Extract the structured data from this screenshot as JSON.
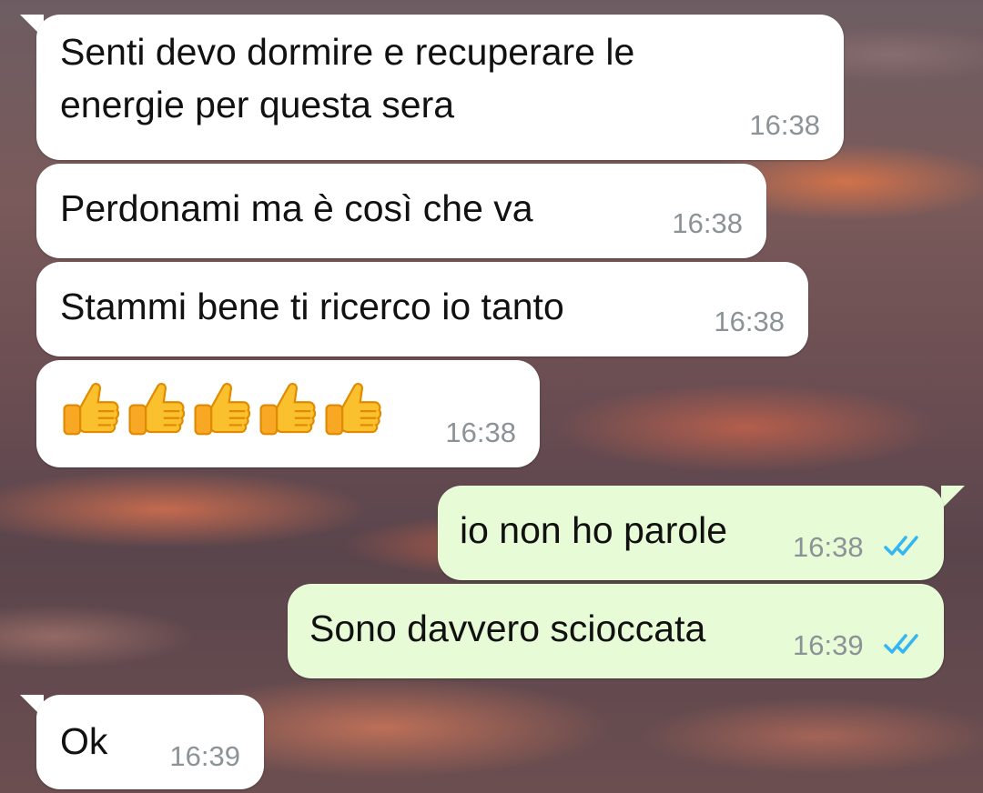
{
  "messages": [
    {
      "direction": "incoming",
      "text_line1": "Senti devo dormire e recuperare le",
      "text_line2": "energie per questa sera",
      "time": "16:38"
    },
    {
      "direction": "incoming",
      "text": "Perdonami ma è così che va",
      "time": "16:38"
    },
    {
      "direction": "incoming",
      "text": "Stammi bene ti ricerco io tanto",
      "time": "16:38"
    },
    {
      "direction": "incoming",
      "emoji": [
        "thumbs-up-icon",
        "thumbs-up-icon",
        "thumbs-up-icon",
        "thumbs-up-icon",
        "thumbs-up-icon"
      ],
      "time": "16:38"
    },
    {
      "direction": "outgoing",
      "text": "io non ho parole",
      "time": "16:38",
      "status": "read"
    },
    {
      "direction": "outgoing",
      "text": "Sono davvero scioccata",
      "time": "16:39",
      "status": "read"
    },
    {
      "direction": "incoming",
      "text": "Ok",
      "time": "16:39"
    }
  ],
  "colors": {
    "incoming_bubble": "#ffffff",
    "outgoing_bubble": "#e7fbd7",
    "read_ticks": "#34b7f1",
    "timestamp": "#8c9397"
  }
}
